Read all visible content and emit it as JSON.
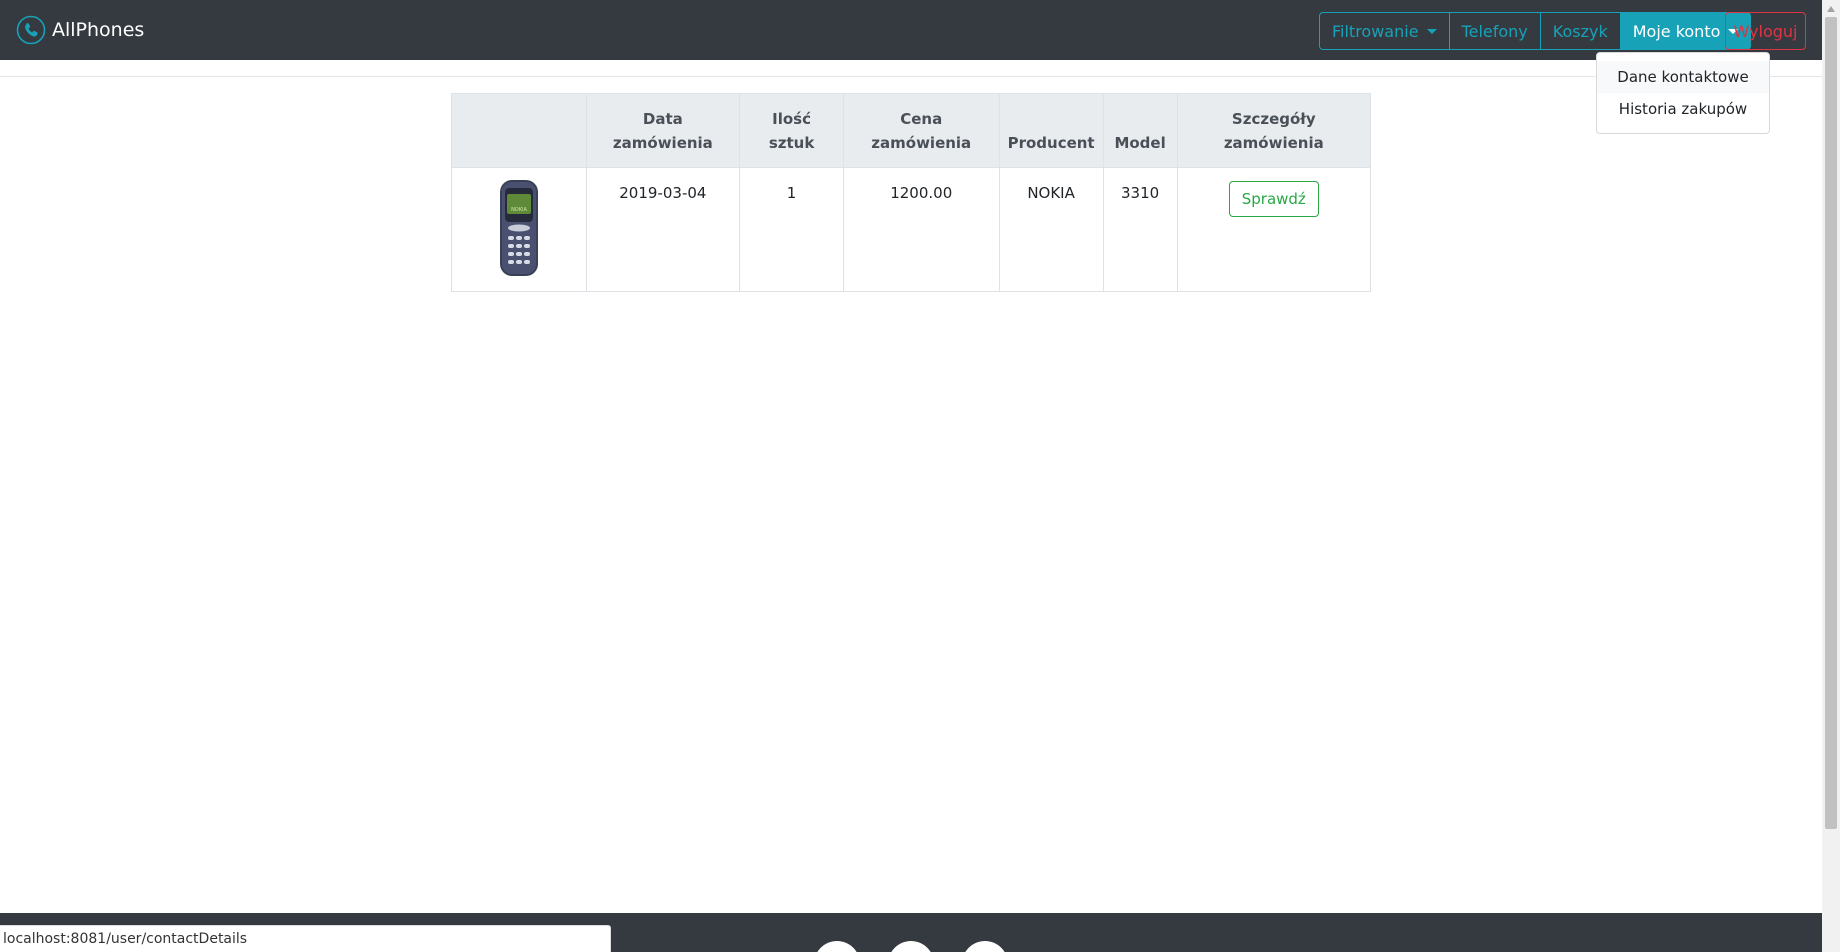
{
  "brand": {
    "name": "AllPhones"
  },
  "nav": {
    "filter_label": "Filtrowanie",
    "phones_label": "Telefony",
    "cart_label": "Koszyk",
    "account_label": "Moje konto",
    "logout_label": "Wyloguj"
  },
  "account_menu": {
    "items": [
      "Dane kontaktowe",
      "Historia zakupów"
    ]
  },
  "orders_table": {
    "headers": [
      "",
      "Data zamówienia",
      "Ilość sztuk",
      "Cena zamówienia",
      "Producent",
      "Model",
      "Szczegóły zamówienia"
    ],
    "rows": [
      {
        "image": "nokia-3310-phone",
        "date": "2019-03-04",
        "quantity": "1",
        "price": "1200.00",
        "producer": "NOKIA",
        "model": "3310",
        "details_label": "Sprawdź"
      }
    ]
  },
  "status_bar": {
    "url": "localhost:8081/user/contactDetails"
  },
  "colors": {
    "navbar": "#343a40",
    "info": "#17a2b8",
    "danger": "#dc3545",
    "success": "#28a745"
  }
}
